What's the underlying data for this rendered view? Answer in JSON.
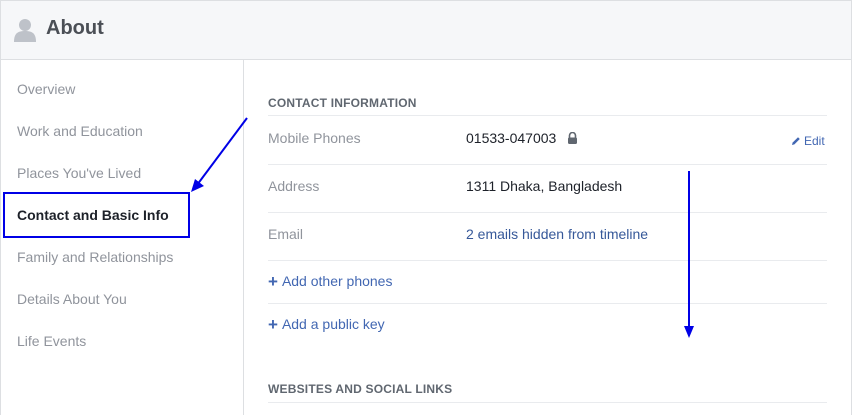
{
  "header": {
    "title": "About",
    "icon": "person-silhouette-icon"
  },
  "sidebar": {
    "items": [
      {
        "label": "Overview",
        "active": false
      },
      {
        "label": "Work and Education",
        "active": false
      },
      {
        "label": "Places You've Lived",
        "active": false
      },
      {
        "label": "Contact and Basic Info",
        "active": true
      },
      {
        "label": "Family and Relationships",
        "active": false
      },
      {
        "label": "Details About You",
        "active": false
      },
      {
        "label": "Life Events",
        "active": false
      }
    ]
  },
  "contact": {
    "section_title": "CONTACT INFORMATION",
    "mobile": {
      "label": "Mobile Phones",
      "value": "01533-047003",
      "privacy_icon": "lock-icon"
    },
    "edit_label": "Edit",
    "address": {
      "label": "Address",
      "value": "1311 Dhaka, Bangladesh"
    },
    "email": {
      "label": "Email",
      "value": "2 emails hidden from timeline"
    },
    "add_phones_label": "Add other phones",
    "add_key_label": "Add a public key"
  },
  "websites": {
    "section_title": "WEBSITES AND SOCIAL LINKS"
  },
  "colors": {
    "link": "#4267b2",
    "header_bg": "#f6f7f9",
    "border": "#dddfe2",
    "annotation": "#0000e6"
  }
}
